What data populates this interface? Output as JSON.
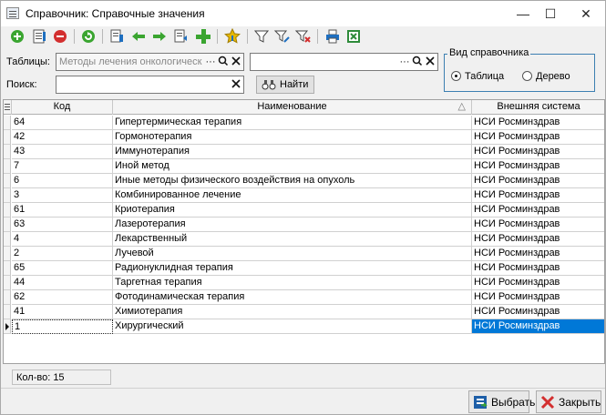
{
  "window": {
    "title": "Справочник: Справочные значения"
  },
  "window_controls": {
    "minimize": "—",
    "maximize": "☐",
    "close": "✕"
  },
  "toolbar": {
    "buttons": [
      "add-icon",
      "edit-icon",
      "delete-icon",
      "refresh-icon",
      "copy-icon",
      "arrow-left-icon",
      "arrow-right-icon",
      "import-icon",
      "plus-icon",
      "favorite-icon",
      "filter-icon",
      "filter-edit-icon",
      "filter-clear-icon",
      "print-icon",
      "excel-icon"
    ],
    "colors": {
      "green": "#3aa530",
      "red": "#d32f2f",
      "blue": "#1e6fc0",
      "yellow": "#e6b800"
    }
  },
  "filters": {
    "tables_label": "Таблицы:",
    "tables_value": "Методы лечения онкологическ",
    "tables_ellipsis": "···",
    "search_label": "Поиск:",
    "search_value": "",
    "find_label": "Найти"
  },
  "view_group": {
    "title": "Вид справочника",
    "options": [
      {
        "label": "Таблица",
        "selected": true
      },
      {
        "label": "Дерево",
        "selected": false
      }
    ]
  },
  "grid": {
    "columns": [
      "Код",
      "Наименование",
      "Внешняя система"
    ],
    "sort_indicator": "△",
    "rows": [
      {
        "code": "64",
        "name": "Гипертермическая терапия",
        "system": "НСИ Росминздрав"
      },
      {
        "code": "42",
        "name": "Гормонотерапия",
        "system": "НСИ Росминздрав"
      },
      {
        "code": "43",
        "name": "Иммунотерапия",
        "system": "НСИ Росминздрав"
      },
      {
        "code": "7",
        "name": "Иной метод",
        "system": "НСИ Росминздрав"
      },
      {
        "code": "6",
        "name": "Иные методы физического воздействия на опухоль",
        "system": "НСИ Росминздрав"
      },
      {
        "code": "3",
        "name": "Комбинированное лечение",
        "system": "НСИ Росминздрав"
      },
      {
        "code": "61",
        "name": "Криотерапия",
        "system": "НСИ Росминздрав"
      },
      {
        "code": "63",
        "name": "Лазеротерапия",
        "system": "НСИ Росминздрав"
      },
      {
        "code": "4",
        "name": "Лекарственный",
        "system": "НСИ Росминздрав"
      },
      {
        "code": "2",
        "name": "Лучевой",
        "system": "НСИ Росминздрав"
      },
      {
        "code": "65",
        "name": "Радионуклидная терапия",
        "system": "НСИ Росминздрав"
      },
      {
        "code": "44",
        "name": "Таргетная терапия",
        "system": "НСИ Росминздрав"
      },
      {
        "code": "62",
        "name": "Фотодинамическая терапия",
        "system": "НСИ Росминздрав"
      },
      {
        "code": "41",
        "name": "Химиотерапия",
        "system": "НСИ Росминздрав"
      },
      {
        "code": "1",
        "name": "Хирургический",
        "system": "НСИ Росминздрав"
      }
    ],
    "selected_index": 14,
    "selection_color": "#0078d7"
  },
  "footer": {
    "count_label": "Кол-во: 15",
    "select_label": "Выбрать",
    "close_label": "Закрыть"
  }
}
